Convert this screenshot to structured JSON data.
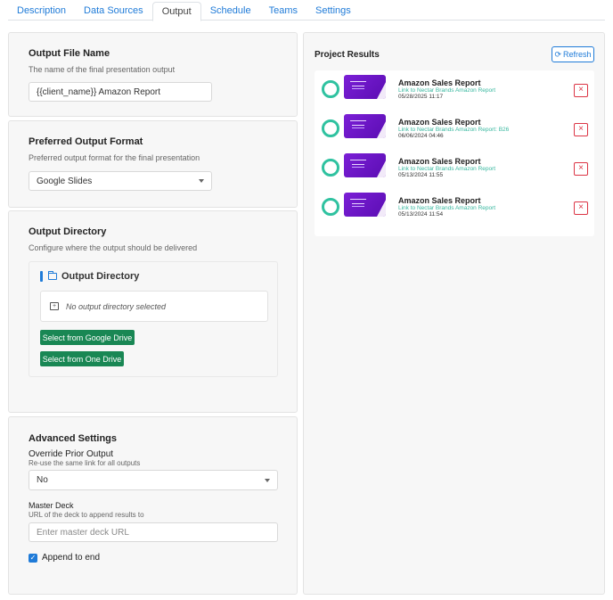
{
  "tabs": [
    "Description",
    "Data Sources",
    "Output",
    "Schedule",
    "Teams",
    "Settings"
  ],
  "output_file": {
    "title": "Output File Name",
    "description": "The name of the final presentation output",
    "value": "{{client_name}} Amazon Report"
  },
  "output_format": {
    "title": "Preferred Output Format",
    "description": "Preferred output format for the final presentation",
    "selected": "Google Slides"
  },
  "output_directory": {
    "title": "Output Directory",
    "description": "Configure where the output should be delivered",
    "panel_title": "Output Directory",
    "empty_text": "No output directory selected",
    "google_drive_button": "Select from Google Drive",
    "one_drive_button": "Select from One Drive"
  },
  "advanced": {
    "title": "Advanced Settings",
    "override_label": "Override Prior Output",
    "override_desc": "Re-use the same link for all outputs",
    "override_value": "No",
    "master_deck_label": "Master Deck",
    "master_deck_desc": "URL of the deck to append results to",
    "master_deck_placeholder": "Enter master deck URL",
    "append_label": "Append to end",
    "append_checked": true
  },
  "project_results": {
    "title": "Project Results",
    "refresh_label": "Refresh",
    "items": [
      {
        "title": "Amazon Sales Report",
        "link": "Link to Nectar Brands Amazon Report",
        "date": "05/28/2025 11:17"
      },
      {
        "title": "Amazon Sales Report",
        "link": "Link to Nectar Brands Amazon Report: B26",
        "date": "06/06/2024 04:46"
      },
      {
        "title": "Amazon Sales Report",
        "link": "Link to Nectar Brands Amazon Report",
        "date": "05/13/2024 11:55"
      },
      {
        "title": "Amazon Sales Report",
        "link": "Link to Nectar Brands Amazon Report",
        "date": "05/13/2024 11:54"
      }
    ]
  },
  "colors": {
    "accent": "#1f7bd8",
    "success": "#198754",
    "ring": "#2fc2a0",
    "danger": "#dc3545",
    "thumb": "#7b1fd6"
  },
  "icons": {
    "folder": "folder-icon",
    "folder_add": "folder-plus-icon",
    "refresh": "refresh-icon",
    "delete": "close-icon",
    "caret": "chevron-down-icon",
    "check": "check-icon"
  }
}
